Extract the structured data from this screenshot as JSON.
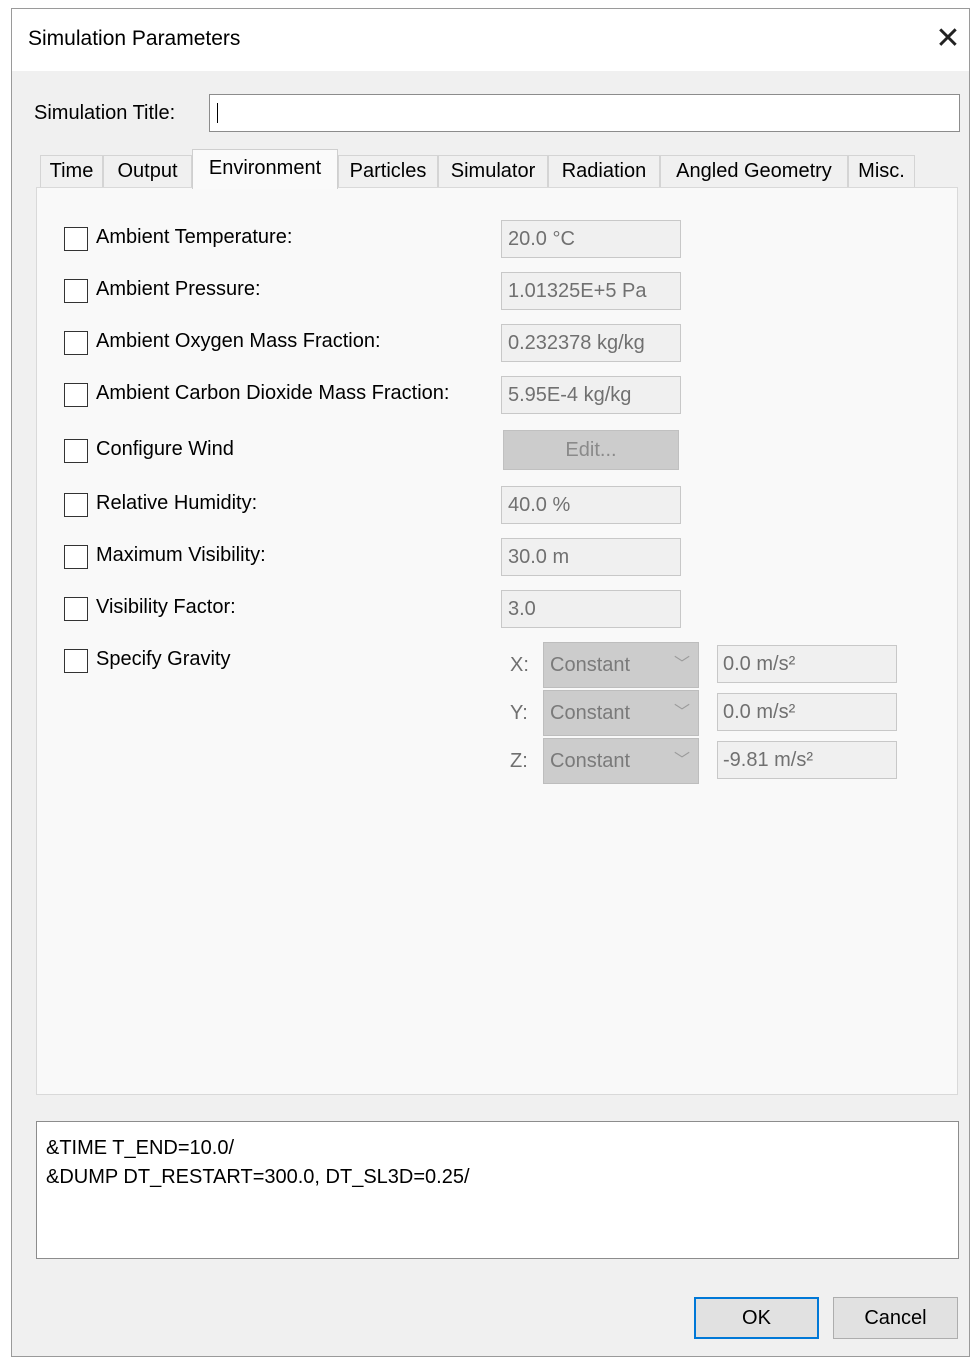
{
  "window": {
    "title": "Simulation Parameters"
  },
  "simulation_title": {
    "label": "Simulation Title:",
    "value": ""
  },
  "tabs": [
    {
      "label": "Time"
    },
    {
      "label": "Output"
    },
    {
      "label": "Environment",
      "active": true
    },
    {
      "label": "Particles"
    },
    {
      "label": "Simulator"
    },
    {
      "label": "Radiation"
    },
    {
      "label": "Angled Geometry"
    },
    {
      "label": "Misc."
    }
  ],
  "environment": {
    "ambient_temperature": {
      "label": "Ambient Temperature:",
      "value": "20.0 °C",
      "checked": false
    },
    "ambient_pressure": {
      "label": "Ambient Pressure:",
      "value": "1.01325E+5 Pa",
      "checked": false
    },
    "ambient_oxygen": {
      "label": "Ambient Oxygen Mass Fraction:",
      "value": "0.232378 kg/kg",
      "checked": false
    },
    "ambient_co2": {
      "label": "Ambient Carbon Dioxide Mass Fraction:",
      "value": "5.95E-4 kg/kg",
      "checked": false
    },
    "configure_wind": {
      "label": "Configure Wind",
      "button": "Edit...",
      "checked": false
    },
    "relative_humidity": {
      "label": "Relative Humidity:",
      "value": "40.0 %",
      "checked": false
    },
    "maximum_visibility": {
      "label": "Maximum Visibility:",
      "value": "30.0 m",
      "checked": false
    },
    "visibility_factor": {
      "label": "Visibility Factor:",
      "value": "3.0",
      "checked": false
    },
    "gravity": {
      "label": "Specify Gravity",
      "checked": false,
      "axes": [
        {
          "axis": "X:",
          "mode": "Constant",
          "value": "0.0 m/s²"
        },
        {
          "axis": "Y:",
          "mode": "Constant",
          "value": "0.0 m/s²"
        },
        {
          "axis": "Z:",
          "mode": "Constant",
          "value": "-9.81 m/s²"
        }
      ]
    }
  },
  "output_preview": {
    "lines": [
      "&TIME T_END=10.0/",
      "&DUMP DT_RESTART=300.0, DT_SL3D=0.25/"
    ]
  },
  "buttons": {
    "ok": "OK",
    "cancel": "Cancel"
  }
}
